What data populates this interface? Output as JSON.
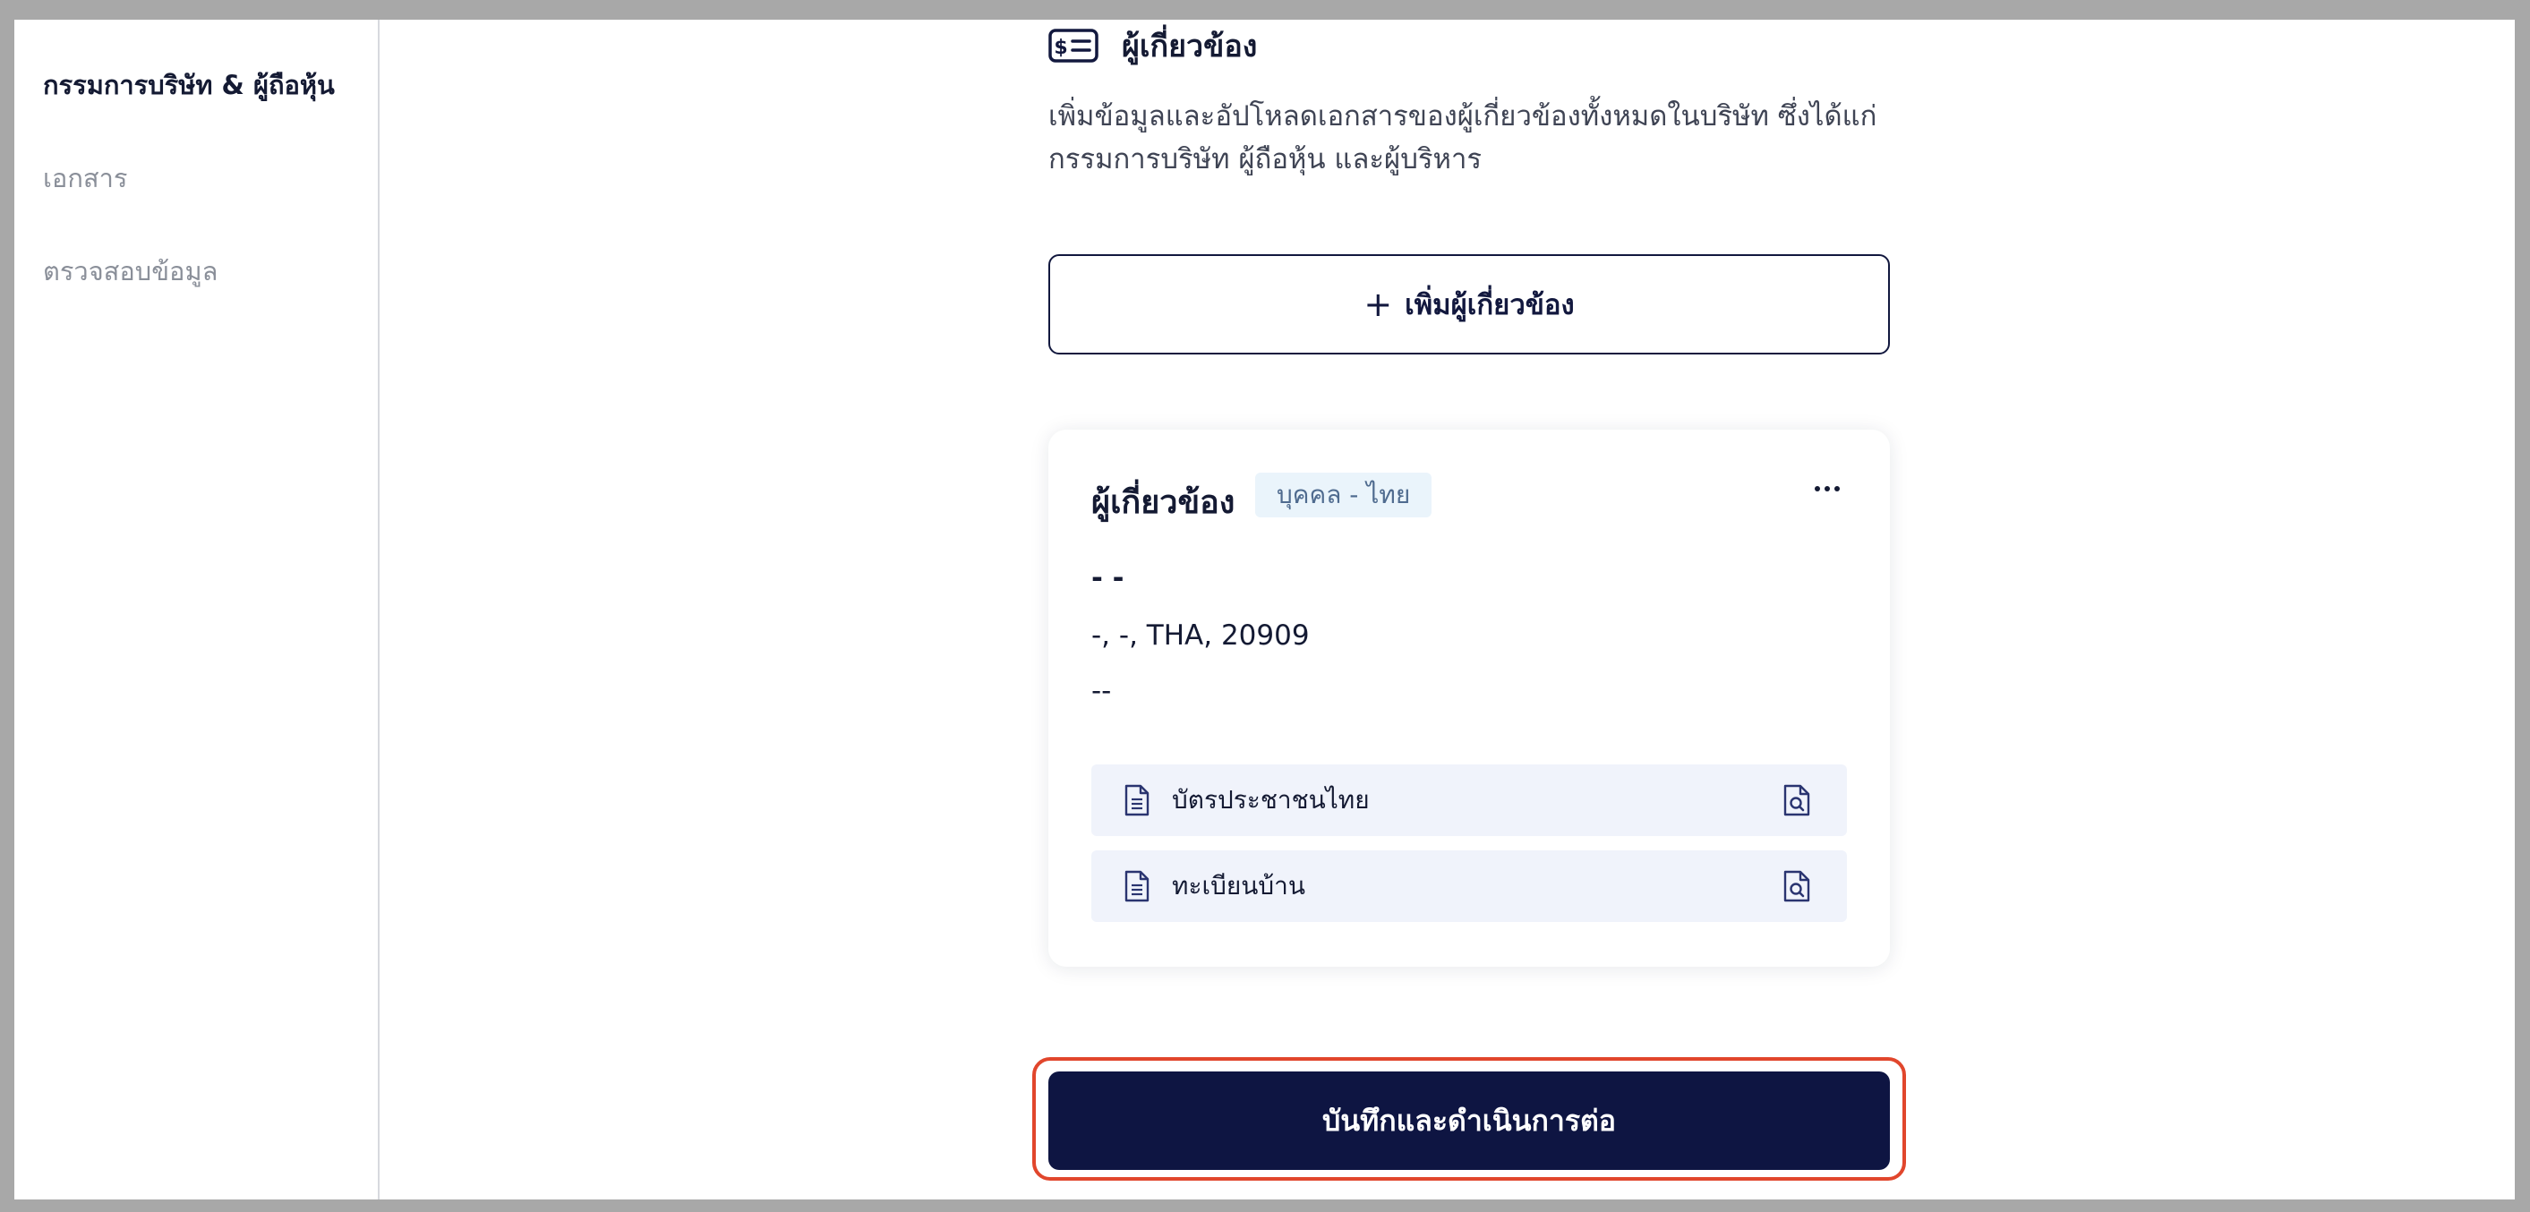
{
  "sidebar": {
    "items": [
      {
        "label": "กรรมการบริษัท & ผู้ถือหุ้น",
        "active": true
      },
      {
        "label": "เอกสาร",
        "active": false
      },
      {
        "label": "ตรวจสอบข้อมูล",
        "active": false
      }
    ]
  },
  "section": {
    "icon": "money-card-icon",
    "title": "ผู้เกี่ยวข้อง",
    "description": "เพิ่มข้อมูลและอัปโหลดเอกสารของผู้เกี่ยวข้องทั้งหมดในบริษัท ซึ่งได้แก่ กรรมการบริษัท ผู้ถือหุ้น และผู้บริหาร",
    "add_button": "เพิ่มผู้เกี่ยวข้อง"
  },
  "card": {
    "title": "ผู้เกี่ยวข้อง",
    "badge": "บุคคล - ไทย",
    "more_icon": "more-horizontal-icon",
    "name": "- -",
    "address": "-, -, THA, 20909",
    "contact": "--",
    "documents": [
      {
        "label": "บัตรประชาชนไทย"
      },
      {
        "label": "ทะเบียนบ้าน"
      }
    ]
  },
  "footer": {
    "save_button": "บันทึกและดำเนินการต่อ",
    "highlight_color": "#e1462c"
  },
  "colors": {
    "primary": "#0e1542",
    "badge_bg": "#eaf4fb",
    "doc_row_bg": "#f0f3fb"
  }
}
